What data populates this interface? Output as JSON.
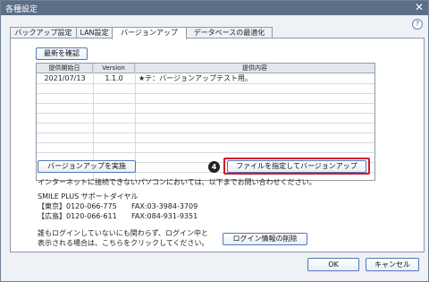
{
  "window": {
    "title": "各種設定",
    "close_glyph": "✕"
  },
  "help": {
    "glyph": "?"
  },
  "tabs": [
    {
      "label": "バックアップ設定",
      "active": false
    },
    {
      "label": "LAN設定",
      "active": false
    },
    {
      "label": "バージョンアップ",
      "active": true
    },
    {
      "label": "データベースの最適化",
      "active": false
    }
  ],
  "panel": {
    "check_latest_label": "最新を確認",
    "table": {
      "columns": [
        "提供開始日",
        "Version",
        "提供内容"
      ],
      "rows": [
        {
          "date": "2021/07/13",
          "version": "1.1.0",
          "content": "★テ：バージョンアップテスト用。"
        }
      ]
    },
    "run_update_label": "バージョンアップを実施",
    "step_badge": "4",
    "file_update_label": "ファイルを指定してバージョンアップ",
    "offline_note": "インターネットに接続できないパソコンにおいては、以下までお問い合わせください。",
    "support": {
      "title": "SMILE PLUS サポートダイヤル",
      "tokyo": "【東京】0120-066-775",
      "tokyo_fax": "FAX:03-3984-3709",
      "hiroshima": "【広島】0120-066-611",
      "hiroshima_fax": "FAX:084-931-9351"
    },
    "login_note_1": "誰もログインしていないにも関わらず、ログイン中と",
    "login_note_2": "表示される場合は、こちらをクリックしてください。",
    "clear_login_label": "ログイン情報の削除"
  },
  "footer": {
    "ok_label": "OK",
    "cancel_label": "キャンセル"
  },
  "colors": {
    "titlebar": "#5b6e86",
    "highlight": "#d3172b",
    "button_border": "#5277b5"
  }
}
